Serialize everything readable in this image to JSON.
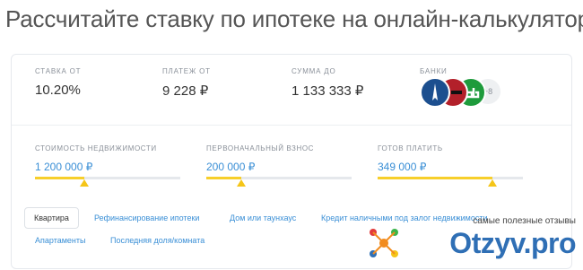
{
  "page": {
    "title": "Рассчитайте ставку по ипотеке на онлайн-калькуляторе"
  },
  "stats": {
    "rate": {
      "label": "СТАВКА ОТ",
      "value": "10.20%"
    },
    "payment": {
      "label": "ПЛАТЕЖ ОТ",
      "value": "9 228 ₽"
    },
    "amount": {
      "label": "СУММА ДО",
      "value": "1 133 333 ₽"
    },
    "banks": {
      "label": "БАНКИ",
      "more": "+8",
      "logo_colors": [
        "#1c4f8f",
        "#b3202a",
        "#1e9b3c"
      ]
    }
  },
  "sliders": [
    {
      "label": "СТОИМОСТЬ НЕДВИЖИМОСТИ",
      "value": "1 200 000 ₽",
      "fill_percent": 34
    },
    {
      "label": "ПЕРВОНАЧАЛЬНЫЙ ВЗНОС",
      "value": "200 000 ₽",
      "fill_percent": 24
    },
    {
      "label": "ГОТОВ ПЛАТИТЬ",
      "value": "349 000 ₽",
      "fill_percent": 79
    }
  ],
  "tabs": [
    {
      "label": "Квартира",
      "active": true
    },
    {
      "label": "Рефинансирование ипотеки",
      "active": false
    },
    {
      "label": "Дом или таунхаус",
      "active": false
    },
    {
      "label": "Кредит наличными под залог недвижимости",
      "active": false
    },
    {
      "label": "Апартаменты",
      "active": false
    },
    {
      "label": "Последняя доля/комната",
      "active": false
    }
  ],
  "watermark": {
    "tagline": "самые полезные отзывы",
    "brand": "Otzyv.pro"
  },
  "colors": {
    "accent": "#3a8fd6",
    "slider": "#f5c518",
    "brand": "#2f6fb5"
  }
}
